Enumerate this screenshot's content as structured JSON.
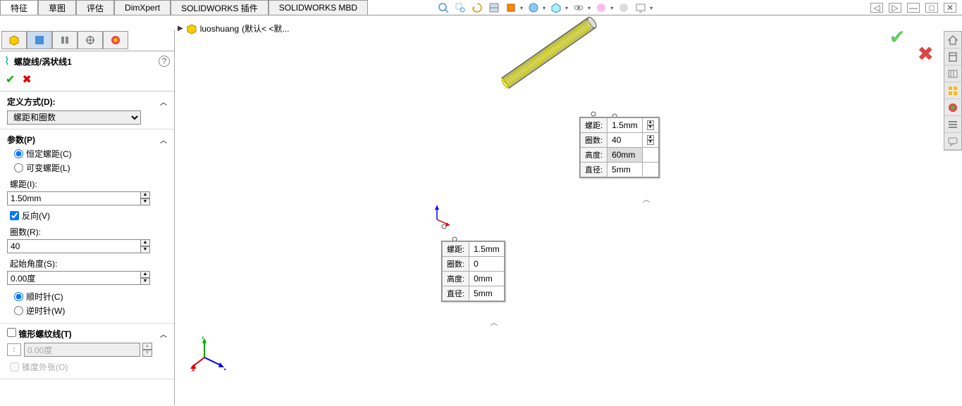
{
  "tabs": [
    "特征",
    "草图",
    "评估",
    "DimXpert",
    "SOLIDWORKS 插件",
    "SOLIDWORKS MBD"
  ],
  "active_tab": 0,
  "breadcrumb": {
    "part": "luoshuang",
    "suffix": "(默认< <默..."
  },
  "feature": {
    "name": "螺旋线/涡状线1"
  },
  "sections": {
    "def": {
      "title": "定义方式(D):",
      "value": "螺距和圈数"
    },
    "params": {
      "title": "参数(P)",
      "pitch_mode": {
        "constant": "恒定螺距(C)",
        "variable": "可变螺距(L)",
        "selected": "constant"
      },
      "pitch": {
        "label": "螺距(I):",
        "value": "1.50mm"
      },
      "reverse": {
        "label": "反向(V)",
        "checked": true
      },
      "rev": {
        "label": "圈数(R):",
        "value": "40"
      },
      "angle": {
        "label": "起始角度(S):",
        "value": "0.00度"
      },
      "direction": {
        "cw": "顺时针(C)",
        "ccw": "逆时针(W)",
        "selected": "cw"
      }
    },
    "taper": {
      "title": "锥形螺纹线(T)",
      "checked": false,
      "angle": "0.00度",
      "outward": "锥度外张(O)"
    }
  },
  "callouts": {
    "top": {
      "pitch_l": "螺距:",
      "pitch": "1.5mm",
      "rev_l": "圈数:",
      "rev": "40",
      "height_l": "高度:",
      "height": "60mm",
      "dia_l": "直径:",
      "dia": "5mm"
    },
    "bottom": {
      "pitch_l": "螺距:",
      "pitch": "1.5mm",
      "rev_l": "圈数:",
      "rev": "0",
      "height_l": "高度:",
      "height": "0mm",
      "dia_l": "直径:",
      "dia": "5mm"
    }
  },
  "hud_icons": [
    "zoom",
    "zoom-area",
    "prev-view",
    "section",
    "display",
    "appearance",
    "scene",
    "view",
    "hide",
    "render",
    "screen",
    "monitor"
  ],
  "right_icons": [
    "home",
    "layers",
    "sheet",
    "pattern",
    "color",
    "list",
    "options"
  ]
}
